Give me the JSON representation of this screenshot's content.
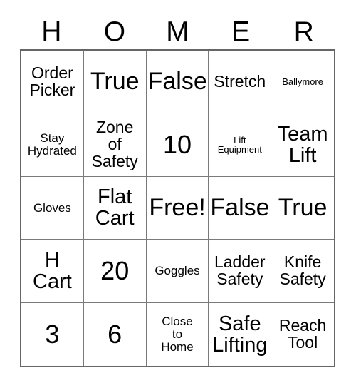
{
  "card": {
    "header_letters": [
      "H",
      "O",
      "M",
      "E",
      "R"
    ],
    "rows": [
      [
        {
          "text": "Order\nPicker",
          "size": "fs-md"
        },
        {
          "text": "True",
          "size": "fs-xl"
        },
        {
          "text": "False",
          "size": "fs-xl"
        },
        {
          "text": "Stretch",
          "size": "fs-md"
        },
        {
          "text": "Ballymore",
          "size": "fs-xs"
        }
      ],
      [
        {
          "text": "Stay\nHydrated",
          "size": "fs-sm"
        },
        {
          "text": "Zone\nof\nSafety",
          "size": "fs-md"
        },
        {
          "text": "10",
          "size": "fs-num"
        },
        {
          "text": "Lift\nEquipment",
          "size": "fs-xs"
        },
        {
          "text": "Team\nLift",
          "size": "fs-lg"
        }
      ],
      [
        {
          "text": "Gloves",
          "size": "fs-sm"
        },
        {
          "text": "Flat\nCart",
          "size": "fs-lg"
        },
        {
          "text": "Free!",
          "size": "fs-xl"
        },
        {
          "text": "False",
          "size": "fs-xl"
        },
        {
          "text": "True",
          "size": "fs-xl"
        }
      ],
      [
        {
          "text": "H\nCart",
          "size": "fs-lg"
        },
        {
          "text": "20",
          "size": "fs-num"
        },
        {
          "text": "Goggles",
          "size": "fs-sm"
        },
        {
          "text": "Ladder\nSafety",
          "size": "fs-md"
        },
        {
          "text": "Knife\nSafety",
          "size": "fs-md"
        }
      ],
      [
        {
          "text": "3",
          "size": "fs-num"
        },
        {
          "text": "6",
          "size": "fs-num"
        },
        {
          "text": "Close\nto\nHome",
          "size": "fs-sm"
        },
        {
          "text": "Safe\nLifting",
          "size": "fs-lg"
        },
        {
          "text": "Reach\nTool",
          "size": "fs-md"
        }
      ]
    ],
    "colors": {
      "text": "#000000",
      "background": "#ffffff",
      "inner_border": "#7a7a7a",
      "outer_border": "#666666"
    }
  }
}
